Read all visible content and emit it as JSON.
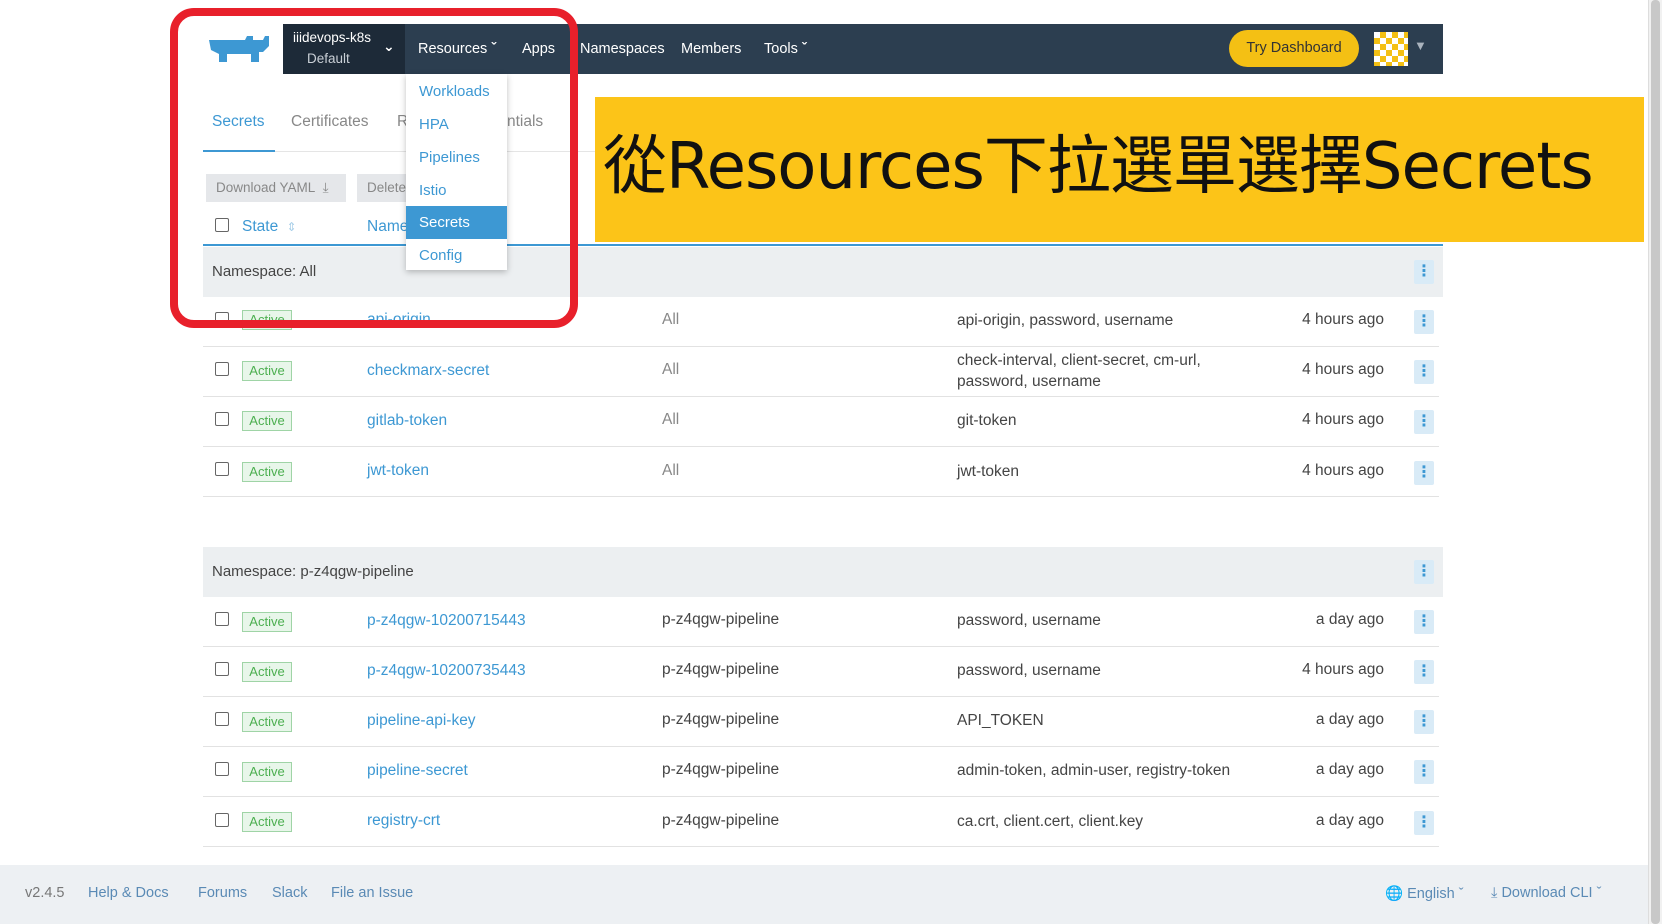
{
  "header": {
    "cluster_name": "iiidevops-k8s",
    "project_name": "Default",
    "nav": [
      "Resources",
      "Apps",
      "Namespaces",
      "Members",
      "Tools"
    ],
    "try_dashboard": "Try Dashboard"
  },
  "resources_menu": [
    "Workloads",
    "HPA",
    "Pipelines",
    "Istio",
    "Secrets",
    "Config"
  ],
  "tabs": [
    "Secrets",
    "Certificates",
    "R",
    "ntials"
  ],
  "buttons": {
    "download_yaml": "Download YAML",
    "delete": "Delete"
  },
  "table": {
    "headers": {
      "state": "State",
      "name": "Name"
    },
    "groups": [
      {
        "label": "Namespace: All",
        "rows": [
          {
            "state": "Active",
            "name": "api-origin",
            "namespace": "All",
            "keys": "api-origin, password, username",
            "age": "4 hours ago"
          },
          {
            "state": "Active",
            "name": "checkmarx-secret",
            "namespace": "All",
            "keys": "check-interval, client-secret, cm-url,",
            "keys2": "password, username",
            "age": "4 hours ago"
          },
          {
            "state": "Active",
            "name": "gitlab-token",
            "namespace": "All",
            "keys": "git-token",
            "age": "4 hours ago"
          },
          {
            "state": "Active",
            "name": "jwt-token",
            "namespace": "All",
            "keys": "jwt-token",
            "age": "4 hours ago"
          }
        ]
      },
      {
        "label": "Namespace: p-z4qgw-pipeline",
        "rows": [
          {
            "state": "Active",
            "name": "p-z4qgw-10200715443",
            "namespace": "p-z4qgw-pipeline",
            "keys": "password, username",
            "age": "a day ago"
          },
          {
            "state": "Active",
            "name": "p-z4qgw-10200735443",
            "namespace": "p-z4qgw-pipeline",
            "keys": "password, username",
            "age": "4 hours ago"
          },
          {
            "state": "Active",
            "name": "pipeline-api-key",
            "namespace": "p-z4qgw-pipeline",
            "keys": "API_TOKEN",
            "age": "a day ago"
          },
          {
            "state": "Active",
            "name": "pipeline-secret",
            "namespace": "p-z4qgw-pipeline",
            "keys": "admin-token, admin-user, registry-token",
            "age": "a day ago"
          },
          {
            "state": "Active",
            "name": "registry-crt",
            "namespace": "p-z4qgw-pipeline",
            "keys": "ca.crt, client.cert, client.key",
            "age": "a day ago"
          }
        ]
      }
    ]
  },
  "annotation": "從Resources下拉選單選擇Secrets",
  "footer": {
    "version": "v2.4.5",
    "links": [
      "Help & Docs",
      "Forums",
      "Slack",
      "File an Issue"
    ],
    "language": "English",
    "download_cli": "Download CLI"
  },
  "colors": {
    "accent": "#3d98d3",
    "header_bg": "#2c3e50",
    "highlight": "#e8202b",
    "annotation_bg": "#fcc418",
    "active_badge": "#4caf50"
  }
}
